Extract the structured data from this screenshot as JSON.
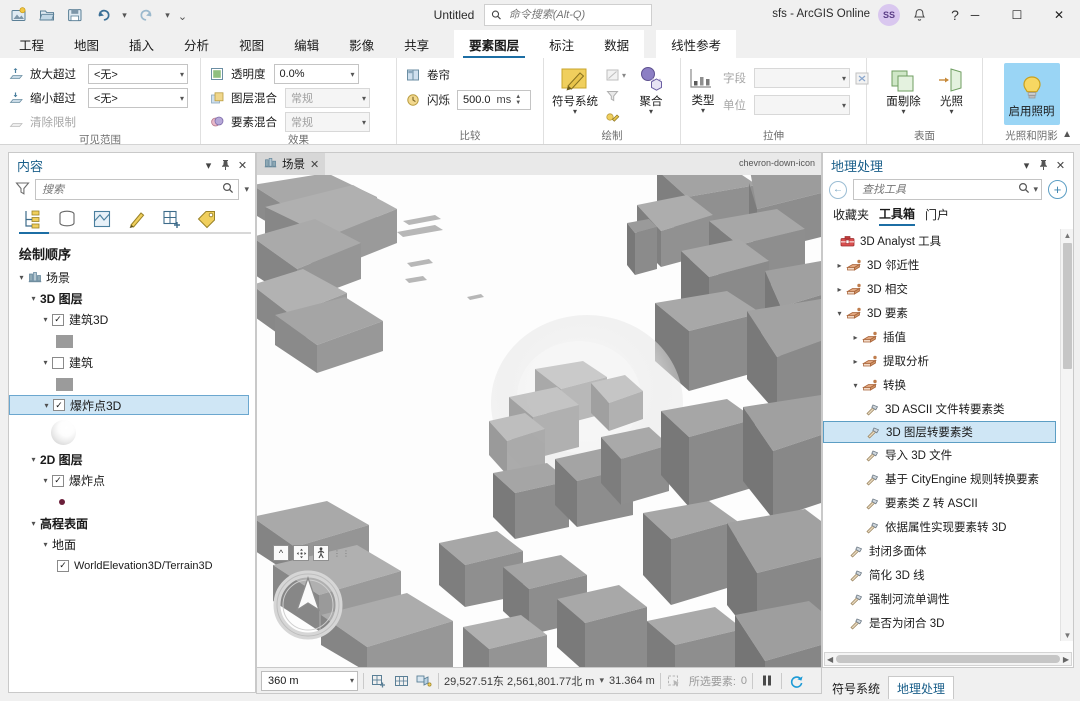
{
  "titlebar": {
    "quick_access": [
      {
        "name": "new-project-icon",
        "glyph": "ὛC"
      },
      {
        "name": "open-project-icon",
        "glyph": ""
      },
      {
        "name": "save-project-icon",
        "glyph": ""
      },
      {
        "name": "undo-icon",
        "glyph": "↶"
      },
      {
        "name": "redo-icon",
        "glyph": "↷"
      },
      {
        "name": "customize-qat-icon",
        "glyph": "⌄"
      }
    ],
    "document_title": "Untitled",
    "search_placeholder": "命令搜索(Alt-Q)",
    "account_label": "sfs - ArcGIS Online",
    "avatar_initials": "SS",
    "notifications_icon": "bell-icon",
    "help_icon": "question-icon",
    "minimize": "─",
    "maximize": "☐",
    "close": "✕"
  },
  "ribbon_tabs": {
    "standard": [
      "工程",
      "地图",
      "插入",
      "分析",
      "视图",
      "编辑",
      "影像",
      "共享"
    ],
    "contextual": [
      "要素图层",
      "标注",
      "数据"
    ],
    "extra": [
      "线性参考"
    ],
    "active": "要素图层"
  },
  "ribbon": {
    "groups": [
      {
        "name": "visible-range",
        "label": "可见范围",
        "rows": [
          {
            "icon": "zoom-in-beyond-icon",
            "label": "放大超过",
            "control": "combo",
            "value": "<无>",
            "disabled": false
          },
          {
            "icon": "zoom-out-beyond-icon",
            "label": "缩小超过",
            "control": "combo",
            "value": "<无>",
            "disabled": false
          },
          {
            "icon": "clear-limits-icon",
            "label": "清除限制",
            "control": "none",
            "value": "",
            "disabled": true
          }
        ]
      },
      {
        "name": "effects",
        "label": "效果",
        "rows": [
          {
            "icon": "transparency-icon",
            "label": "透明度",
            "control": "combo",
            "value": "0.0%",
            "disabled": false
          },
          {
            "icon": "layer-blend-icon",
            "label": "图层混合",
            "control": "combo",
            "value": "常规",
            "disabled": true
          },
          {
            "icon": "feature-blend-icon",
            "label": "要素混合",
            "control": "combo",
            "value": "常规",
            "disabled": true
          }
        ]
      },
      {
        "name": "compare",
        "label": "比较",
        "rows": [
          {
            "icon": "swipe-icon",
            "label": "卷帘",
            "control": "none",
            "value": "",
            "disabled": false
          },
          {
            "icon": "flicker-icon",
            "label": "闪烁",
            "control": "spin",
            "value": "500.0",
            "unit": "ms",
            "disabled": false
          }
        ]
      },
      {
        "name": "drawing",
        "label": "绘制",
        "buttons": [
          {
            "name": "symbology-button",
            "label": "符号系统",
            "icon": "symbology-icon",
            "has_caret": true
          },
          {
            "name": "aggregation-button",
            "label": "聚合",
            "icon": "aggregation-icon",
            "has_caret": true
          }
        ],
        "small_icons": [
          "filter-visibility-icon",
          "funnel-icon",
          "edit-symbol-icon"
        ]
      },
      {
        "name": "extrusion",
        "label": "拉伸",
        "type_button": {
          "name": "type-button",
          "label": "类型",
          "icon": "extrusion-type-icon",
          "has_caret": true
        },
        "fields": [
          {
            "label": "字段",
            "value": "",
            "disabled": true
          },
          {
            "label": "单位",
            "value": "",
            "disabled": true
          }
        ],
        "calc_icon": "expression-builder-icon"
      },
      {
        "name": "surface",
        "label": "表面",
        "buttons": [
          {
            "name": "face-culling-button",
            "label": "面剔除",
            "icon": "face-cull-icon",
            "has_caret": true
          },
          {
            "name": "lighting-button",
            "label": "光照",
            "icon": "lighting-icon",
            "has_caret": true
          }
        ]
      },
      {
        "name": "lighting-shadows",
        "label": "光照和阴影",
        "buttons": [
          {
            "name": "enable-lighting-button",
            "label": "启用照明",
            "icon": "lightbulb-icon",
            "active": true
          }
        ]
      }
    ],
    "collapse_icon": "chevron-up-icon"
  },
  "contents_panel": {
    "title": "内容",
    "header_buttons": [
      "menu-chevron-icon",
      "pin-icon",
      "close-icon"
    ],
    "filter_icon": "funnel-icon",
    "search_placeholder": "搜索",
    "search_icon": "search-icon",
    "dropdown_icon": "chevron-down-icon",
    "view_tabs": [
      {
        "name": "list-by-draw-order-tab",
        "icon": "draw-order-icon",
        "active": true
      },
      {
        "name": "list-by-data-source-tab",
        "icon": "database-icon",
        "active": false
      },
      {
        "name": "list-by-selection-tab",
        "icon": "selection-icon",
        "active": false
      },
      {
        "name": "list-by-editing-tab",
        "icon": "pencil-icon",
        "active": false
      },
      {
        "name": "list-by-snapping-tab",
        "icon": "grid-plus-icon",
        "active": false
      },
      {
        "name": "list-by-labeling-tab",
        "icon": "label-tag-icon",
        "active": false
      }
    ],
    "section_title": "绘制顺序",
    "tree": [
      {
        "label": "场景",
        "type": "scene",
        "indent": 0,
        "twisty": "down",
        "icon": "scene-icon",
        "checkbox": null
      },
      {
        "label": "3D 图层",
        "type": "group",
        "indent": 1,
        "twisty": "down",
        "bold": true,
        "checkbox": null
      },
      {
        "label": "建筑3D",
        "type": "layer",
        "indent": 2,
        "twisty": "down",
        "checkbox": true
      },
      {
        "label": "",
        "type": "swatch-square",
        "indent": 3
      },
      {
        "label": "建筑",
        "type": "layer",
        "indent": 2,
        "twisty": "down",
        "checkbox": false
      },
      {
        "label": "",
        "type": "swatch-square",
        "indent": 3
      },
      {
        "label": "爆炸点3D",
        "type": "layer",
        "indent": 2,
        "twisty": "down",
        "checkbox": true,
        "selected": true
      },
      {
        "label": "",
        "type": "swatch-sphere",
        "indent": 3
      },
      {
        "label": "2D 图层",
        "type": "group",
        "indent": 1,
        "twisty": "down",
        "bold": true,
        "checkbox": null
      },
      {
        "label": "爆炸点",
        "type": "layer",
        "indent": 2,
        "twisty": "down",
        "checkbox": true
      },
      {
        "label": "",
        "type": "swatch-dot",
        "indent": 3
      },
      {
        "label": "高程表面",
        "type": "group",
        "indent": 1,
        "twisty": "down",
        "bold": true,
        "checkbox": null
      },
      {
        "label": "地面",
        "type": "group",
        "indent": 2,
        "twisty": "down",
        "checkbox": null
      },
      {
        "label": "WorldElevation3D/Terrain3D",
        "type": "layer",
        "indent": 3,
        "twisty": "none",
        "checkbox": true
      }
    ]
  },
  "mapview": {
    "tab_label": "场景",
    "tab_icon": "scene-icon",
    "tab_close": "✕",
    "overflow_icon": "chevron-down-icon",
    "nav_tools": [
      {
        "name": "full-extent-tool",
        "glyph": "⌃"
      },
      {
        "name": "pan-tool",
        "glyph": "✣"
      },
      {
        "name": "walk-tool",
        "glyph": "Ὣ6"
      }
    ],
    "nav_dots": "⋮⋮",
    "compass_name": "navigation-compass"
  },
  "statusbar": {
    "scale_value": "360 m",
    "icons": [
      "add-grid-icon",
      "grid-icon",
      "3d-measure-icon"
    ],
    "coordinates": "29,527.51东 2,561,801.77北 m",
    "coord_caret": "⌄",
    "elevation": "31.364 m",
    "selection_icon": "selection-icon",
    "selection_label": "所选要素:",
    "selection_count": "0",
    "pause_icon": "pause-icon",
    "refresh_icon": "refresh-icon"
  },
  "geoprocessing_panel": {
    "title": "地理处理",
    "header_buttons": [
      "menu-chevron-icon",
      "pin-icon",
      "close-icon"
    ],
    "back_icon": "back-arrow-icon",
    "search_placeholder": "查找工具",
    "search_icon": "search-icon",
    "dropdown_icon": "chevron-down-icon",
    "add_icon": "plus-circle-icon",
    "tabs": [
      {
        "label": "收藏夹",
        "active": false
      },
      {
        "label": "工具箱",
        "active": true
      },
      {
        "label": "门户",
        "active": false
      }
    ],
    "tree": [
      {
        "label": "3D Analyst 工具",
        "indent": 0,
        "twisty": "none",
        "icon": "toolbox-icon"
      },
      {
        "label": "3D 邻近性",
        "indent": 1,
        "twisty": "right",
        "icon": "toolset-icon"
      },
      {
        "label": "3D 相交",
        "indent": 1,
        "twisty": "right",
        "icon": "toolset-icon"
      },
      {
        "label": "3D 要素",
        "indent": 1,
        "twisty": "down",
        "icon": "toolset-icon"
      },
      {
        "label": "插值",
        "indent": 2,
        "twisty": "right",
        "icon": "toolset-icon"
      },
      {
        "label": "提取分析",
        "indent": 2,
        "twisty": "right",
        "icon": "toolset-icon"
      },
      {
        "label": "转换",
        "indent": 2,
        "twisty": "down",
        "icon": "toolset-icon"
      },
      {
        "label": "3D ASCII 文件转要素类",
        "indent": 3,
        "twisty": "none",
        "icon": "tool-icon"
      },
      {
        "label": "3D 图层转要素类",
        "indent": 3,
        "twisty": "none",
        "icon": "tool-icon",
        "selected": true
      },
      {
        "label": "导入 3D 文件",
        "indent": 3,
        "twisty": "none",
        "icon": "tool-icon"
      },
      {
        "label": "基于 CityEngine 规则转换要素",
        "indent": 3,
        "twisty": "none",
        "icon": "tool-icon"
      },
      {
        "label": "要素类 Z 转 ASCII",
        "indent": 3,
        "twisty": "none",
        "icon": "tool-icon"
      },
      {
        "label": "依据属性实现要素转 3D",
        "indent": 3,
        "twisty": "none",
        "icon": "tool-icon"
      },
      {
        "label": "封闭多面体",
        "indent": 2,
        "twisty": "none",
        "icon": "tool-icon"
      },
      {
        "label": "简化 3D 线",
        "indent": 2,
        "twisty": "none",
        "icon": "tool-icon"
      },
      {
        "label": "强制河流单调性",
        "indent": 2,
        "twisty": "none",
        "icon": "tool-icon"
      },
      {
        "label": "是否为闭合 3D",
        "indent": 2,
        "twisty": "none",
        "icon": "tool-icon"
      }
    ],
    "bottom_tabs": [
      {
        "label": "符号系统",
        "active": false
      },
      {
        "label": "地理处理",
        "active": true
      }
    ]
  },
  "colors": {
    "accent": "#1c6ea4",
    "selection": "#cfe6f5",
    "ribbon_active": "#9ad5f5",
    "panel_title": "#1a5f8a",
    "symbol_swatch": "#9b9b9b",
    "point_swatch": "#6b1f3a",
    "building_light": "#b8b8b8",
    "building_mid": "#9e9e9e",
    "building_dark": "#868686",
    "ground": "#fdfdfd"
  }
}
